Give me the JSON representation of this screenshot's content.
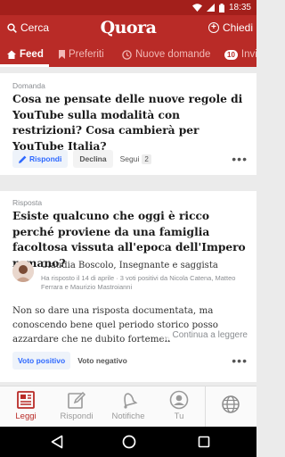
{
  "status_bar": {
    "time": "18:35",
    "wifi_icon": "wifi-icon",
    "signal_icon": "signal-icon",
    "battery_icon": "battery-icon"
  },
  "app_bar": {
    "search_label": "Cerca",
    "logo": "Quora",
    "ask_label": "Chiedi",
    "accent": "#b92b27"
  },
  "tabs": [
    {
      "label": "Feed",
      "icon": "home-icon",
      "active": true
    },
    {
      "label": "Preferiti",
      "icon": "bookmark-icon",
      "active": false
    },
    {
      "label": "Nuove domande",
      "icon": "clock-icon",
      "active": false
    },
    {
      "label": "Invi",
      "badge": "10",
      "active": false
    }
  ],
  "feed": [
    {
      "type_label": "Domanda",
      "title": "Cosa ne pensate delle nuove regole di YouTube sulla modalità con restrizioni? Cosa cambierà per YouTube Italia?",
      "answer_label": "Rispondi",
      "decline_label": "Declina",
      "follow_label": "Segui",
      "follow_count": "2"
    },
    {
      "type_label": "Risposta",
      "title": "Esiste qualcuno che oggi è ricco perché proviene da una famiglia facoltosa vissuta all'epoca dell'Impero romano?",
      "author": "Claudia Boscolo, Insegnante e saggista",
      "meta": "Ha risposto il 14 di aprile · 3 voti positivi da Nicola Catena, Matteo Ferrara e Maurizio Mastroianni",
      "text_main": "Non so dare una risposta documentata, ma conoscendo bene quel periodo storico posso azzardare che ne dubito fortemen",
      "continue_label": "Continua a leggere",
      "upvote_label": "Voto positivo",
      "downvote_label": "Voto negativo"
    }
  ],
  "bottom_nav": [
    {
      "label": "Leggi",
      "icon": "read-icon",
      "active": true
    },
    {
      "label": "Rispondi",
      "icon": "pencil-icon",
      "active": false
    },
    {
      "label": "Notifiche",
      "icon": "bell-icon",
      "active": false
    },
    {
      "label": "Tu",
      "icon": "profile-icon",
      "active": false
    },
    {
      "label": "",
      "icon": "globe-icon",
      "active": false
    }
  ],
  "system_nav": {
    "back_icon": "back-icon",
    "home_icon": "home-circle-icon",
    "recents_icon": "recents-icon"
  }
}
